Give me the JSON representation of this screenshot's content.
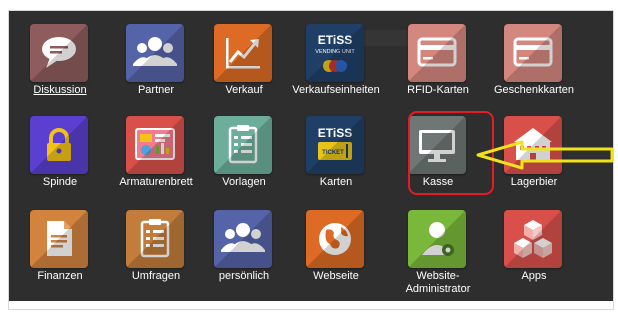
{
  "tiles": [
    {
      "label": "Diskussion",
      "color": "#8e5c5c",
      "icon": "chat-bubble-icon",
      "underline": true
    },
    {
      "label": "Partner",
      "color": "#5563a8",
      "icon": "users-icon"
    },
    {
      "label": "Verkauf",
      "color": "#dd6b25",
      "icon": "trend-chart-icon"
    },
    {
      "label": "Verkaufseinheiten",
      "color": "#1f3f66",
      "icon": "etiss-vending-logo",
      "logo_text": "ETiSS",
      "sub_text": "VENDING UNIT"
    },
    {
      "label": "RFID-Karten",
      "color": "#d4877f",
      "icon": "card-icon"
    },
    {
      "label": "Geschenkkarten",
      "color": "#d4877f",
      "icon": "card-icon"
    },
    {
      "label": "Spinde",
      "color": "#5a3fd0",
      "icon": "padlock-icon"
    },
    {
      "label": "Armaturenbrett",
      "color": "#d9504a",
      "icon": "dashboard-icon"
    },
    {
      "label": "Vorlagen",
      "color": "#6cae99",
      "icon": "clipboard-icon"
    },
    {
      "label": "Karten",
      "color": "#1f3f66",
      "icon": "etiss-ticket-logo",
      "logo_text": "ETiSS",
      "sub_text": "TICKET"
    },
    {
      "label": "Kasse",
      "color": "#6e7775",
      "icon": "monitor-icon"
    },
    {
      "label": "Lagerbier",
      "color": "#d9504a",
      "icon": "building-icon"
    },
    {
      "label": "Finanzen",
      "color": "#d2843e",
      "icon": "document-icon"
    },
    {
      "label": "Umfragen",
      "color": "#c27c3b",
      "icon": "survey-clipboard-icon"
    },
    {
      "label": "persönlich",
      "color": "#5563a8",
      "icon": "users-icon"
    },
    {
      "label": "Webseite",
      "color": "#dd6b25",
      "icon": "globe-icon"
    },
    {
      "label": "Website-\nAdministrator",
      "color": "#7ab83b",
      "icon": "admin-user-icon"
    },
    {
      "label": "Apps",
      "color": "#d9504a",
      "icon": "cubes-icon"
    }
  ],
  "annotation": {
    "highlight_color": "#e21d25",
    "arrow_color": "#f2e21a",
    "highlighted_tile": "Kasse"
  }
}
